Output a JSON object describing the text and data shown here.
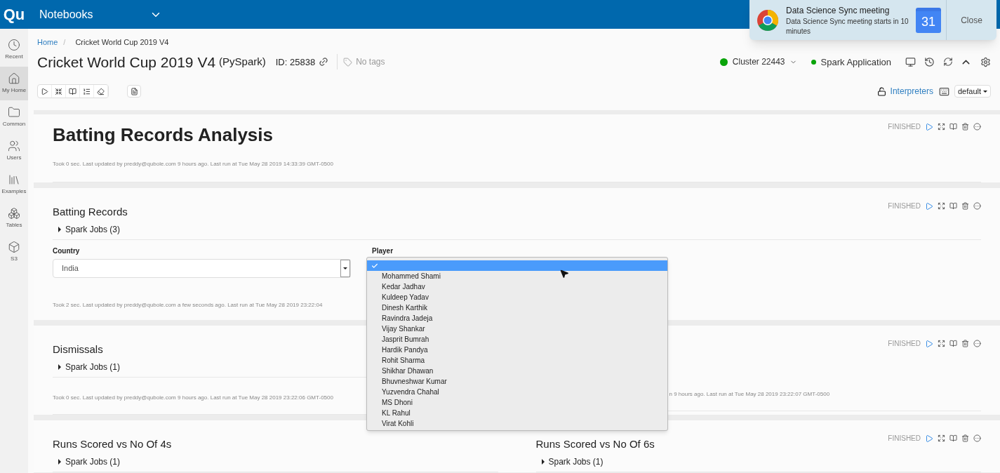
{
  "topbar": {
    "logo": "Qu",
    "title": "Notebooks"
  },
  "sidebar": {
    "items": [
      {
        "label": "Recent",
        "selected": false
      },
      {
        "label": "My Home",
        "selected": true
      },
      {
        "label": "Common",
        "selected": false
      },
      {
        "label": "Users",
        "selected": false
      },
      {
        "label": "Examples",
        "selected": false
      },
      {
        "label": "Tables",
        "selected": false
      },
      {
        "label": "S3",
        "selected": false
      }
    ]
  },
  "breadcrumb": {
    "items": [
      "Home",
      "Cricket World Cup 2019 V4"
    ],
    "separator": "/"
  },
  "notebook": {
    "title": "Cricket World Cup 2019 V4",
    "language": "(PySpark)",
    "id": "ID: 25838",
    "tags_placeholder": "No tags"
  },
  "cluster": {
    "name": "Cluster 22443",
    "running": true
  },
  "application": {
    "name": "Spark Application",
    "running": true
  },
  "interpreters": "Interpreters",
  "mode": "default",
  "rows": [
    [
      {
        "kind": "heading",
        "title": "Batting Records Analysis",
        "status": "FINISHED",
        "meta": "Took 0 sec. Last updated by preddy@qubole.com 9 hours ago. Last run at Tue May 28 2019 14:33:39 GMT-0500"
      }
    ],
    [
      {
        "kind": "section",
        "title": "Batting Records",
        "status": "FINISHED",
        "jobs": "Spark Jobs (3)",
        "form": {
          "country_label": "Country",
          "country_value": "India",
          "player_label": "Player"
        },
        "meta": "Took 2 sec. Last updated by preddy@qubole.com a few seconds ago. Last run at Tue May 28 2019 23:22:04"
      }
    ],
    [
      {
        "kind": "section",
        "title": "Dismissals",
        "jobs": "Spark Jobs (1)",
        "meta": "Took 0 sec. Last updated by preddy@qubole.com 9 hours ago. Last run at Tue May 28 2019 23:22:06 GMT-0500"
      },
      {
        "kind": "covered",
        "status": "FINISHED",
        "meta": "n 9 hours ago. Last run at Tue May 28 2019 23:22:07 GMT-0500"
      }
    ],
    [
      {
        "kind": "section",
        "title": "Runs Scored vs No Of 4s",
        "jobs": "Spark Jobs (1)"
      },
      {
        "kind": "section",
        "title": "Runs Scored vs No Of 6s",
        "status": "FINISHED",
        "jobs": "Spark Jobs (1)"
      }
    ]
  ],
  "player_dropdown": {
    "blank_selected": true,
    "options": [
      "Mohammed Shami",
      "Kedar Jadhav",
      "Kuldeep Yadav",
      "Dinesh Karthik",
      "Ravindra Jadeja",
      "Vijay Shankar",
      "Jasprit Bumrah",
      "Hardik Pandya",
      "Rohit Sharma",
      "Shikhar Dhawan",
      "Bhuvneshwar Kumar",
      "Yuzvendra Chahal",
      "MS Dhoni",
      "KL Rahul",
      "Virat Kohli"
    ]
  },
  "notification": {
    "title": "Data Science Sync meeting",
    "body": "Data Science Sync meeting starts in 10 minutes",
    "day": "31",
    "action": "Close"
  }
}
